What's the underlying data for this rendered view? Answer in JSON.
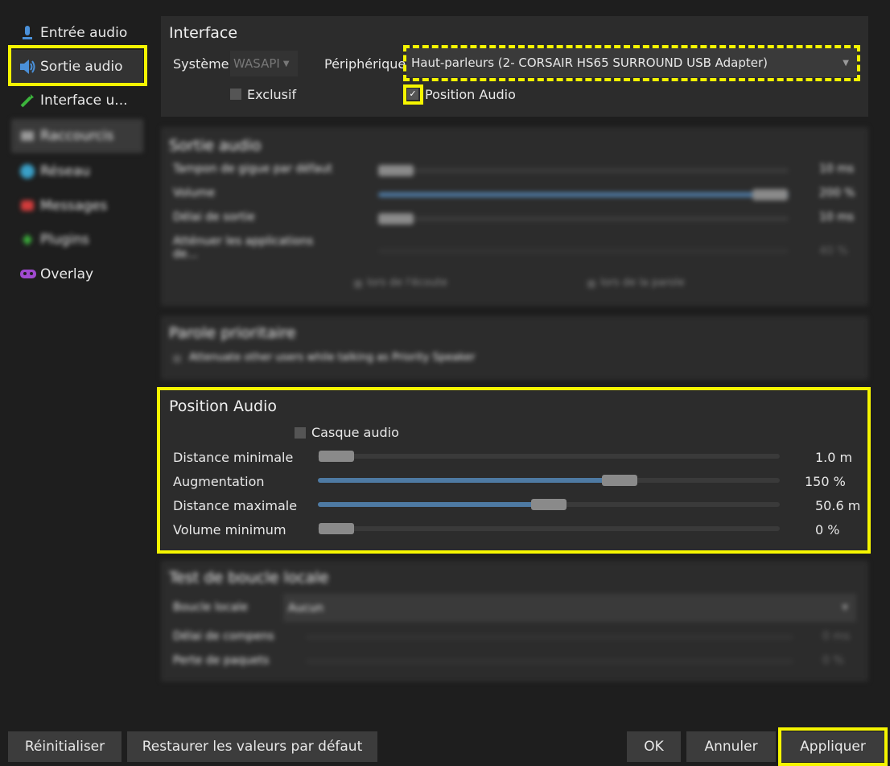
{
  "sidebar": {
    "items": [
      {
        "label": "Entrée audio",
        "icon": "microphone-icon"
      },
      {
        "label": "Sortie audio",
        "icon": "speaker-icon"
      },
      {
        "label": "Interface u...",
        "icon": "wand-icon"
      },
      {
        "label": "Raccourcis",
        "icon": "keyboard-icon"
      },
      {
        "label": "Réseau",
        "icon": "globe-icon"
      },
      {
        "label": "Messages",
        "icon": "chat-icon"
      },
      {
        "label": "Plugins",
        "icon": "puzzle-icon"
      },
      {
        "label": "Overlay",
        "icon": "gamepad-icon"
      }
    ]
  },
  "interface": {
    "title": "Interface",
    "system_label": "Système",
    "system_value": "WASAPI",
    "device_label": "Périphérique",
    "device_value": "Haut-parleurs (2- CORSAIR HS65 SURROUND USB Adapter)",
    "exclusive_label": "Exclusif",
    "positional_label": "Position Audio",
    "positional_checked": true
  },
  "sortie": {
    "title": "Sortie audio",
    "rows": [
      {
        "label": "Tampon de gigue par défaut",
        "value": "10 ms"
      },
      {
        "label": "Volume",
        "value": "200 %"
      },
      {
        "label": "Délai de sortie",
        "value": "10 ms"
      },
      {
        "label": "Atténuer les applications de...",
        "value": "40 %"
      }
    ],
    "while_listening": "lors de l'écoute",
    "while_talking": "lors de la parole"
  },
  "priority": {
    "title": "Parole prioritaire",
    "checkbox": "Attenuate other users while talking as Priority Speaker"
  },
  "position_audio": {
    "title": "Position Audio",
    "headphones_label": "Casque audio",
    "rows": [
      {
        "label": "Distance minimale",
        "value": "1.0 m",
        "level": 0.0
      },
      {
        "label": "Augmentation",
        "value": "150 %",
        "level": 0.64
      },
      {
        "label": "Distance maximale",
        "value": "50.6 m",
        "level": 0.5
      },
      {
        "label": "Volume minimum",
        "value": "0 %",
        "level": 0.0
      }
    ]
  },
  "loopback": {
    "title": "Test de boucle locale",
    "mode_label": "Boucle locale",
    "mode_value": "Aucun",
    "delay_label": "Délai de compens",
    "delay_value": "0 ms",
    "loss_label": "Perte de paquets",
    "loss_value": "0 %"
  },
  "footer": {
    "reset": "Réinitialiser",
    "restore": "Restaurer les valeurs par défaut",
    "ok": "OK",
    "cancel": "Annuler",
    "apply": "Appliquer"
  },
  "colors": {
    "highlight": "#f5f500",
    "slider_fill": "#4e7aa3"
  }
}
